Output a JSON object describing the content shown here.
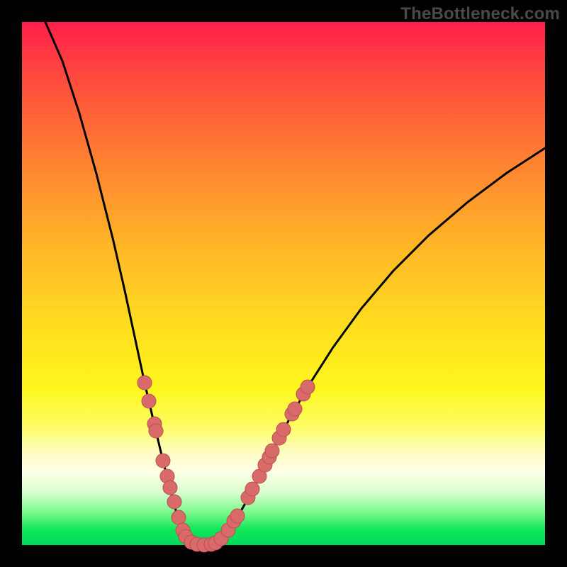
{
  "watermark": {
    "text": "TheBottleneck.com"
  },
  "colors": {
    "bg": "#000000",
    "watermark": "#4a4a4a",
    "curve": "#000000",
    "marker_fill": "#d86b6a",
    "marker_stroke": "#b94f4e"
  },
  "chart_data": {
    "type": "line",
    "title": "",
    "xlabel": "",
    "ylabel": "",
    "xlim": [
      31,
      769
    ],
    "ylim": [
      31,
      769
    ],
    "series": [
      {
        "name": "bottleneck-curve",
        "color": "#000000",
        "points": [
          [
            64,
            31
          ],
          [
            88,
            86
          ],
          [
            112,
            160
          ],
          [
            136,
            245
          ],
          [
            160,
            340
          ],
          [
            176,
            410
          ],
          [
            190,
            475
          ],
          [
            204,
            540
          ],
          [
            218,
            600
          ],
          [
            230,
            650
          ],
          [
            240,
            690
          ],
          [
            248,
            720
          ],
          [
            256,
            742
          ],
          [
            262,
            755
          ],
          [
            268,
            762
          ],
          [
            275,
            766
          ],
          [
            285,
            768
          ],
          [
            298,
            768
          ],
          [
            304,
            766
          ],
          [
            310,
            762
          ],
          [
            318,
            754
          ],
          [
            325,
            745
          ],
          [
            335,
            730
          ],
          [
            345,
            712
          ],
          [
            357,
            690
          ],
          [
            370,
            665
          ],
          [
            388,
            630
          ],
          [
            410,
            588
          ],
          [
            438,
            540
          ],
          [
            470,
            490
          ],
          [
            510,
            435
          ],
          [
            555,
            382
          ],
          [
            605,
            332
          ],
          [
            660,
            285
          ],
          [
            715,
            244
          ],
          [
            769,
            209
          ]
        ]
      }
    ],
    "markers": [
      {
        "x": 204,
        "y": 540
      },
      {
        "x": 210,
        "y": 566
      },
      {
        "x": 218,
        "y": 598
      },
      {
        "x": 220,
        "y": 608
      },
      {
        "x": 230,
        "y": 650
      },
      {
        "x": 236,
        "y": 672
      },
      {
        "x": 240,
        "y": 688
      },
      {
        "x": 246,
        "y": 708
      },
      {
        "x": 252,
        "y": 730
      },
      {
        "x": 258,
        "y": 748
      },
      {
        "x": 262,
        "y": 757
      },
      {
        "x": 270,
        "y": 765
      },
      {
        "x": 278,
        "y": 768
      },
      {
        "x": 288,
        "y": 769
      },
      {
        "x": 298,
        "y": 768
      },
      {
        "x": 304,
        "y": 766
      },
      {
        "x": 312,
        "y": 760
      },
      {
        "x": 322,
        "y": 748
      },
      {
        "x": 330,
        "y": 735
      },
      {
        "x": 335,
        "y": 728
      },
      {
        "x": 350,
        "y": 702
      },
      {
        "x": 356,
        "y": 690
      },
      {
        "x": 366,
        "y": 672
      },
      {
        "x": 374,
        "y": 656
      },
      {
        "x": 380,
        "y": 645
      },
      {
        "x": 384,
        "y": 636
      },
      {
        "x": 394,
        "y": 618
      },
      {
        "x": 400,
        "y": 606
      },
      {
        "x": 412,
        "y": 584
      },
      {
        "x": 416,
        "y": 577
      },
      {
        "x": 428,
        "y": 556
      },
      {
        "x": 434,
        "y": 546
      }
    ]
  }
}
